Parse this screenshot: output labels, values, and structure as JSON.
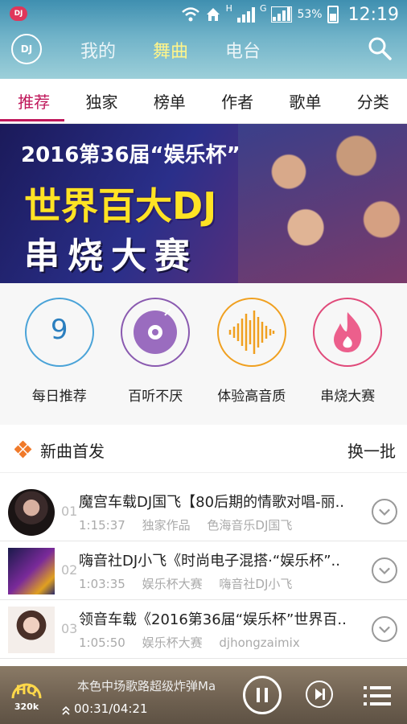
{
  "status_bar": {
    "app_badge": "DJ",
    "network_h": "H",
    "network_g": "G",
    "battery": "53%",
    "time": "12:19"
  },
  "app_bar": {
    "logo": "DJ",
    "nav": [
      "我的",
      "舞曲",
      "电台"
    ],
    "active_nav": "舞曲"
  },
  "tabs": [
    "推荐",
    "独家",
    "榜单",
    "作者",
    "歌单",
    "分类"
  ],
  "banner": {
    "year_line": "2016第36届“娱乐杯”",
    "title": "世界百大DJ",
    "subtitle": "串烧大赛"
  },
  "quick_links": [
    {
      "label": "每日推荐",
      "icon": "calendar-9-icon",
      "number": "9",
      "color": "#4aa3d8"
    },
    {
      "label": "百听不厌",
      "icon": "vinyl-disc-icon",
      "color": "#8a5ab0"
    },
    {
      "label": "体验高音质",
      "icon": "soundwave-icon",
      "color": "#f0a020"
    },
    {
      "label": "串烧大赛",
      "icon": "flame-icon",
      "color": "#e04a7a"
    }
  ],
  "new_songs": {
    "title": "新曲首发",
    "refresh": "换一批",
    "items": [
      {
        "index": "01",
        "name": "魔宫车载DJ国飞【80后期的情歌对唱-丽..",
        "duration": "1:15:37",
        "tag": "独家作品",
        "author": "色海音乐DJ国飞"
      },
      {
        "index": "02",
        "name": "嗨音社DJ小飞《时尚电子混搭·“娱乐杯”..",
        "duration": "1:03:35",
        "tag": "娱乐杯大赛",
        "author": "嗨音社DJ小飞"
      },
      {
        "index": "03",
        "name": "领音车载《2016第36届“娱乐杯”世界百..",
        "duration": "1:05:50",
        "tag": "娱乐杯大赛",
        "author": "djhongzaimix"
      }
    ]
  },
  "player": {
    "quality": "HQ",
    "bitrate": "320k",
    "now_playing": "本色中场歌路超级炸弹Ma",
    "time": "00:31/04:21"
  },
  "colors": {
    "accent": "#c0185b",
    "active_nav": "#fff58a",
    "header": "#5fa6c0"
  }
}
